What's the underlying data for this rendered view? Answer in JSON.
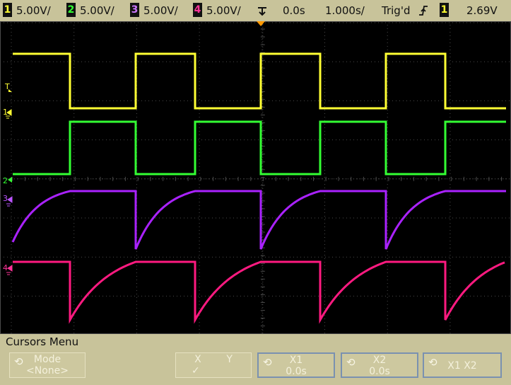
{
  "status_bar": {
    "channels": [
      {
        "num": "1",
        "scale": "5.00V/",
        "color": "#ffff33"
      },
      {
        "num": "2",
        "scale": "5.00V/",
        "color": "#33ff33"
      },
      {
        "num": "3",
        "scale": "5.00V/",
        "color": "#aa33ff"
      },
      {
        "num": "4",
        "scale": "5.00V/",
        "color": "#ff2288"
      }
    ],
    "trigger_icon": "trigger-edge-icon",
    "delay": "0.0s",
    "timebase": "1.000s/",
    "trigger_status": "Trig'd",
    "trigger_slope_icon": "rising-edge-icon",
    "trigger_source": "1",
    "trigger_level": "2.69V"
  },
  "marker_labels": {
    "trigger": "T",
    "ch1": "1",
    "ch2": "2",
    "ch3": "3",
    "ch4": "4"
  },
  "colors": {
    "grid": "#5a5a5a",
    "background": "#000000",
    "panel": "#c8c39a",
    "trigger_marker": "#ff9900"
  },
  "menu": {
    "title": "Cursors Menu",
    "softkeys": [
      {
        "line1": "Mode",
        "line2": "<None>",
        "icon": "rotate-knob-icon",
        "active": false
      },
      {
        "line1": "X        Y",
        "line2": "✓",
        "icon": "",
        "active": false
      },
      {
        "line1": "X1",
        "line2": "0.0s",
        "icon": "rotate-knob-icon",
        "active": true
      },
      {
        "line1": "X2",
        "line2": "0.0s",
        "icon": "rotate-knob-icon",
        "active": true
      },
      {
        "line1": "X1 X2",
        "line2": "",
        "icon": "rotate-knob-icon",
        "active": true
      }
    ]
  }
}
